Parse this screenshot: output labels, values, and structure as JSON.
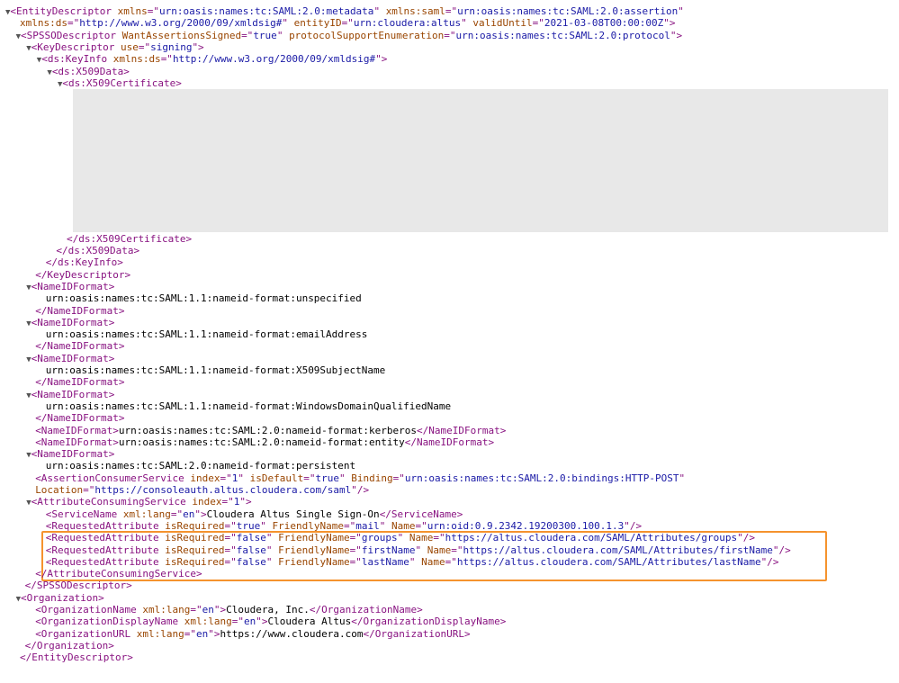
{
  "xml": {
    "expand_symbol": "▼",
    "lines": [
      {
        "indent": 0,
        "toggle": true,
        "parts": [
          [
            "tag",
            "<EntityDescriptor "
          ],
          [
            "attr",
            "xmlns"
          ],
          [
            "tag",
            "=\""
          ],
          [
            "val",
            "urn:oasis:names:tc:SAML:2.0:metadata"
          ],
          [
            "tag",
            "\" "
          ],
          [
            "attr",
            "xmlns:saml"
          ],
          [
            "tag",
            "=\""
          ],
          [
            "val",
            "urn:oasis:names:tc:SAML:2.0:assertion"
          ],
          [
            "tag",
            "\""
          ]
        ]
      },
      {
        "indent": 0,
        "offset": 16,
        "parts": [
          [
            "attr",
            "xmlns:ds"
          ],
          [
            "tag",
            "=\""
          ],
          [
            "val",
            "http://www.w3.org/2000/09/xmldsig#"
          ],
          [
            "tag",
            "\" "
          ],
          [
            "attr",
            "entityID"
          ],
          [
            "tag",
            "=\""
          ],
          [
            "val",
            "urn:cloudera:altus"
          ],
          [
            "tag",
            "\" "
          ],
          [
            "attr",
            "validUntil"
          ],
          [
            "tag",
            "=\""
          ],
          [
            "val",
            "2021-03-08T00:00:00Z"
          ],
          [
            "tag",
            "\">"
          ]
        ]
      },
      {
        "indent": 1,
        "toggle": true,
        "parts": [
          [
            "tag",
            "<SPSSODescriptor "
          ],
          [
            "attr",
            "WantAssertionsSigned"
          ],
          [
            "tag",
            "=\""
          ],
          [
            "val",
            "true"
          ],
          [
            "tag",
            "\" "
          ],
          [
            "attr",
            "protocolSupportEnumeration"
          ],
          [
            "tag",
            "=\""
          ],
          [
            "val",
            "urn:oasis:names:tc:SAML:2.0:protocol"
          ],
          [
            "tag",
            "\">"
          ]
        ]
      },
      {
        "indent": 2,
        "toggle": true,
        "parts": [
          [
            "tag",
            "<KeyDescriptor "
          ],
          [
            "attr",
            "use"
          ],
          [
            "tag",
            "=\""
          ],
          [
            "val",
            "signing"
          ],
          [
            "tag",
            "\">"
          ]
        ]
      },
      {
        "indent": 3,
        "toggle": true,
        "parts": [
          [
            "tag",
            "<ds:KeyInfo "
          ],
          [
            "attr",
            "xmlns:ds"
          ],
          [
            "tag",
            "=\""
          ],
          [
            "val",
            "http://www.w3.org/2000/09/xmldsig#"
          ],
          [
            "tag",
            "\">"
          ]
        ]
      },
      {
        "indent": 4,
        "toggle": true,
        "parts": [
          [
            "tag",
            "<ds:X509Data>"
          ]
        ]
      },
      {
        "indent": 5,
        "toggle": true,
        "parts": [
          [
            "tag",
            "<ds:X509Certificate>"
          ]
        ]
      },
      {
        "indent": 5,
        "offset": 10,
        "skip": 12,
        "parts": [
          [
            "tag",
            "</ds:X509Certificate>"
          ]
        ]
      },
      {
        "indent": 4,
        "offset": 10,
        "parts": [
          [
            "tag",
            "</ds:X509Data>"
          ]
        ]
      },
      {
        "indent": 3,
        "offset": 10,
        "parts": [
          [
            "tag",
            "</ds:KeyInfo>"
          ]
        ]
      },
      {
        "indent": 2,
        "offset": 10,
        "parts": [
          [
            "tag",
            "</KeyDescriptor>"
          ]
        ]
      },
      {
        "indent": 2,
        "toggle": true,
        "parts": [
          [
            "tag",
            "<NameIDFormat>"
          ]
        ]
      },
      {
        "indent": 3,
        "offset": 10,
        "parts": [
          [
            "txt",
            "urn:oasis:names:tc:SAML:1.1:nameid-format:unspecified"
          ]
        ]
      },
      {
        "indent": 2,
        "offset": 10,
        "parts": [
          [
            "tag",
            "</NameIDFormat>"
          ]
        ]
      },
      {
        "indent": 2,
        "toggle": true,
        "parts": [
          [
            "tag",
            "<NameIDFormat>"
          ]
        ]
      },
      {
        "indent": 3,
        "offset": 10,
        "parts": [
          [
            "txt",
            "urn:oasis:names:tc:SAML:1.1:nameid-format:emailAddress"
          ]
        ]
      },
      {
        "indent": 2,
        "offset": 10,
        "parts": [
          [
            "tag",
            "</NameIDFormat>"
          ]
        ]
      },
      {
        "indent": 2,
        "toggle": true,
        "parts": [
          [
            "tag",
            "<NameIDFormat>"
          ]
        ]
      },
      {
        "indent": 3,
        "offset": 10,
        "parts": [
          [
            "txt",
            "urn:oasis:names:tc:SAML:1.1:nameid-format:X509SubjectName"
          ]
        ]
      },
      {
        "indent": 2,
        "offset": 10,
        "parts": [
          [
            "tag",
            "</NameIDFormat>"
          ]
        ]
      },
      {
        "indent": 2,
        "toggle": true,
        "parts": [
          [
            "tag",
            "<NameIDFormat>"
          ]
        ]
      },
      {
        "indent": 3,
        "offset": 10,
        "parts": [
          [
            "txt",
            "urn:oasis:names:tc:SAML:1.1:nameid-format:WindowsDomainQualifiedName"
          ]
        ]
      },
      {
        "indent": 2,
        "offset": 10,
        "parts": [
          [
            "tag",
            "</NameIDFormat>"
          ]
        ]
      },
      {
        "indent": 2,
        "offset": 10,
        "parts": [
          [
            "tag",
            "<NameIDFormat>"
          ],
          [
            "txt",
            "urn:oasis:names:tc:SAML:2.0:nameid-format:kerberos"
          ],
          [
            "tag",
            "</NameIDFormat>"
          ]
        ]
      },
      {
        "indent": 2,
        "offset": 10,
        "parts": [
          [
            "tag",
            "<NameIDFormat>"
          ],
          [
            "txt",
            "urn:oasis:names:tc:SAML:2.0:nameid-format:entity"
          ],
          [
            "tag",
            "</NameIDFormat>"
          ]
        ]
      },
      {
        "indent": 2,
        "toggle": true,
        "parts": [
          [
            "tag",
            "<NameIDFormat>"
          ]
        ]
      },
      {
        "indent": 3,
        "offset": 10,
        "parts": [
          [
            "txt",
            "urn:oasis:names:tc:SAML:2.0:nameid-format:persistent"
          ]
        ]
      },
      {
        "indent": 2,
        "offset": 10,
        "parts": [
          [
            "tag",
            "<AssertionConsumerService "
          ],
          [
            "attr",
            "index"
          ],
          [
            "tag",
            "=\""
          ],
          [
            "val",
            "1"
          ],
          [
            "tag",
            "\" "
          ],
          [
            "attr",
            "isDefault"
          ],
          [
            "tag",
            "=\""
          ],
          [
            "val",
            "true"
          ],
          [
            "tag",
            "\" "
          ],
          [
            "attr",
            "Binding"
          ],
          [
            "tag",
            "=\""
          ],
          [
            "val",
            "urn:oasis:names:tc:SAML:2.0:bindings:HTTP-POST"
          ],
          [
            "tag",
            "\""
          ]
        ]
      },
      {
        "indent": 2,
        "offset": 10,
        "parts": [
          [
            "attr",
            "Location"
          ],
          [
            "tag",
            "=\""
          ],
          [
            "val",
            "https://consoleauth.altus.cloudera.com/saml"
          ],
          [
            "tag",
            "\"/>"
          ]
        ]
      },
      {
        "indent": 2,
        "toggle": true,
        "parts": [
          [
            "tag",
            "<AttributeConsumingService "
          ],
          [
            "attr",
            "index"
          ],
          [
            "tag",
            "=\""
          ],
          [
            "val",
            "1"
          ],
          [
            "tag",
            "\">"
          ]
        ]
      },
      {
        "indent": 3,
        "offset": 10,
        "parts": [
          [
            "tag",
            "<ServiceName "
          ],
          [
            "attr",
            "xml:lang"
          ],
          [
            "tag",
            "=\""
          ],
          [
            "val",
            "en"
          ],
          [
            "tag",
            "\">"
          ],
          [
            "txt",
            "Cloudera Altus Single Sign-On"
          ],
          [
            "tag",
            "</ServiceName>"
          ]
        ]
      },
      {
        "indent": 3,
        "offset": 10,
        "parts": [
          [
            "tag",
            "<RequestedAttribute "
          ],
          [
            "attr",
            "isRequired"
          ],
          [
            "tag",
            "=\""
          ],
          [
            "val",
            "true"
          ],
          [
            "tag",
            "\" "
          ],
          [
            "attr",
            "FriendlyName"
          ],
          [
            "tag",
            "=\""
          ],
          [
            "val",
            "mail"
          ],
          [
            "tag",
            "\" "
          ],
          [
            "attr",
            "Name"
          ],
          [
            "tag",
            "=\""
          ],
          [
            "val",
            "urn:oid:0.9.2342.19200300.100.1.3"
          ],
          [
            "tag",
            "\"/>"
          ]
        ]
      },
      {
        "indent": 3,
        "offset": 10,
        "parts": [
          [
            "tag",
            "<RequestedAttribute "
          ],
          [
            "attr",
            "isRequired"
          ],
          [
            "tag",
            "=\""
          ],
          [
            "val",
            "false"
          ],
          [
            "tag",
            "\" "
          ],
          [
            "attr",
            "FriendlyName"
          ],
          [
            "tag",
            "=\""
          ],
          [
            "val",
            "groups"
          ],
          [
            "tag",
            "\" "
          ],
          [
            "attr",
            "Name"
          ],
          [
            "tag",
            "=\""
          ],
          [
            "val",
            "https://altus.cloudera.com/SAML/Attributes/groups"
          ],
          [
            "tag",
            "\"/>"
          ]
        ]
      },
      {
        "indent": 3,
        "offset": 10,
        "parts": [
          [
            "tag",
            "<RequestedAttribute "
          ],
          [
            "attr",
            "isRequired"
          ],
          [
            "tag",
            "=\""
          ],
          [
            "val",
            "false"
          ],
          [
            "tag",
            "\" "
          ],
          [
            "attr",
            "FriendlyName"
          ],
          [
            "tag",
            "=\""
          ],
          [
            "val",
            "firstName"
          ],
          [
            "tag",
            "\" "
          ],
          [
            "attr",
            "Name"
          ],
          [
            "tag",
            "=\""
          ],
          [
            "val",
            "https://altus.cloudera.com/SAML/Attributes/firstName"
          ],
          [
            "tag",
            "\"/>"
          ]
        ]
      },
      {
        "indent": 3,
        "offset": 10,
        "parts": [
          [
            "tag",
            "<RequestedAttribute "
          ],
          [
            "attr",
            "isRequired"
          ],
          [
            "tag",
            "=\""
          ],
          [
            "val",
            "false"
          ],
          [
            "tag",
            "\" "
          ],
          [
            "attr",
            "FriendlyName"
          ],
          [
            "tag",
            "=\""
          ],
          [
            "val",
            "lastName"
          ],
          [
            "tag",
            "\" "
          ],
          [
            "attr",
            "Name"
          ],
          [
            "tag",
            "=\""
          ],
          [
            "val",
            "https://altus.cloudera.com/SAML/Attributes/lastName"
          ],
          [
            "tag",
            "\"/>"
          ]
        ]
      },
      {
        "indent": 2,
        "offset": 10,
        "parts": [
          [
            "tag",
            "</AttributeConsumingService>"
          ]
        ]
      },
      {
        "indent": 1,
        "offset": 10,
        "parts": [
          [
            "tag",
            "</SPSSODescriptor>"
          ]
        ]
      },
      {
        "indent": 1,
        "toggle": true,
        "parts": [
          [
            "tag",
            "<Organization>"
          ]
        ]
      },
      {
        "indent": 2,
        "offset": 10,
        "parts": [
          [
            "tag",
            "<OrganizationName "
          ],
          [
            "attr",
            "xml:lang"
          ],
          [
            "tag",
            "=\""
          ],
          [
            "val",
            "en"
          ],
          [
            "tag",
            "\">"
          ],
          [
            "txt",
            "Cloudera, Inc."
          ],
          [
            "tag",
            "</OrganizationName>"
          ]
        ]
      },
      {
        "indent": 2,
        "offset": 10,
        "parts": [
          [
            "tag",
            "<OrganizationDisplayName "
          ],
          [
            "attr",
            "xml:lang"
          ],
          [
            "tag",
            "=\""
          ],
          [
            "val",
            "en"
          ],
          [
            "tag",
            "\">"
          ],
          [
            "txt",
            "Cloudera Altus"
          ],
          [
            "tag",
            "</OrganizationDisplayName>"
          ]
        ]
      },
      {
        "indent": 2,
        "offset": 10,
        "parts": [
          [
            "tag",
            "<OrganizationURL "
          ],
          [
            "attr",
            "xml:lang"
          ],
          [
            "tag",
            "=\""
          ],
          [
            "val",
            "en"
          ],
          [
            "tag",
            "\">"
          ],
          [
            "txt",
            "https://www.cloudera.com"
          ],
          [
            "tag",
            "</OrganizationURL>"
          ]
        ]
      },
      {
        "indent": 1,
        "offset": 10,
        "parts": [
          [
            "tag",
            "</Organization>"
          ]
        ]
      },
      {
        "indent": 0,
        "offset": 16,
        "parts": [
          [
            "tag",
            "</EntityDescriptor>"
          ]
        ]
      }
    ]
  },
  "colors": {
    "tag": "#881280",
    "attribute": "#994500",
    "value": "#1a1aa6",
    "highlight_border": "#f5932e",
    "redacted_block": "#e8e8e8"
  }
}
